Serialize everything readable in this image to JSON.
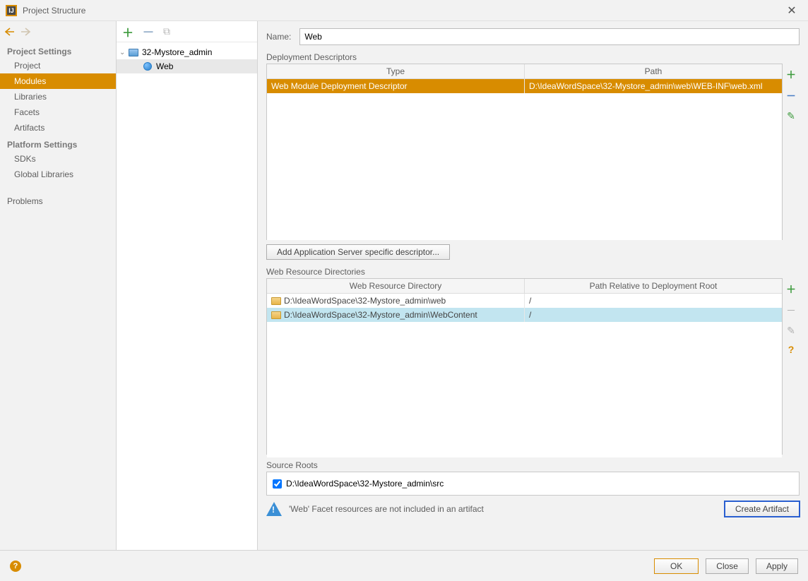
{
  "title": "Project Structure",
  "sidebar": {
    "headings": {
      "project": "Project Settings",
      "platform": "Platform Settings"
    },
    "items": {
      "project": "Project",
      "modules": "Modules",
      "libraries": "Libraries",
      "facets": "Facets",
      "artifacts": "Artifacts",
      "sdks": "SDKs",
      "global_libraries": "Global Libraries",
      "problems": "Problems"
    }
  },
  "tree": {
    "module": "32-Mystore_admin",
    "facet": "Web"
  },
  "form": {
    "name_label": "Name:",
    "name_value": "Web"
  },
  "deployment": {
    "section_label": "Deployment Descriptors",
    "col_type": "Type",
    "col_path": "Path",
    "row_type": "Web Module Deployment Descriptor",
    "row_path": "D:\\IdeaWordSpace\\32-Mystore_admin\\web\\WEB-INF\\web.xml",
    "add_button": "Add Application Server specific descriptor..."
  },
  "resources": {
    "section_label": "Web Resource Directories",
    "col_dir": "Web Resource Directory",
    "col_rel": "Path Relative to Deployment Root",
    "rows": [
      {
        "dir": "D:\\IdeaWordSpace\\32-Mystore_admin\\web",
        "rel": "/"
      },
      {
        "dir": "D:\\IdeaWordSpace\\32-Mystore_admin\\WebContent",
        "rel": "/"
      }
    ]
  },
  "source_roots": {
    "section_label": "Source Roots",
    "value": "D:\\IdeaWordSpace\\32-Mystore_admin\\src"
  },
  "warning": {
    "message": "'Web' Facet resources are not included in an artifact",
    "button": "Create Artifact"
  },
  "footer": {
    "ok": "OK",
    "close": "Close",
    "apply": "Apply"
  }
}
